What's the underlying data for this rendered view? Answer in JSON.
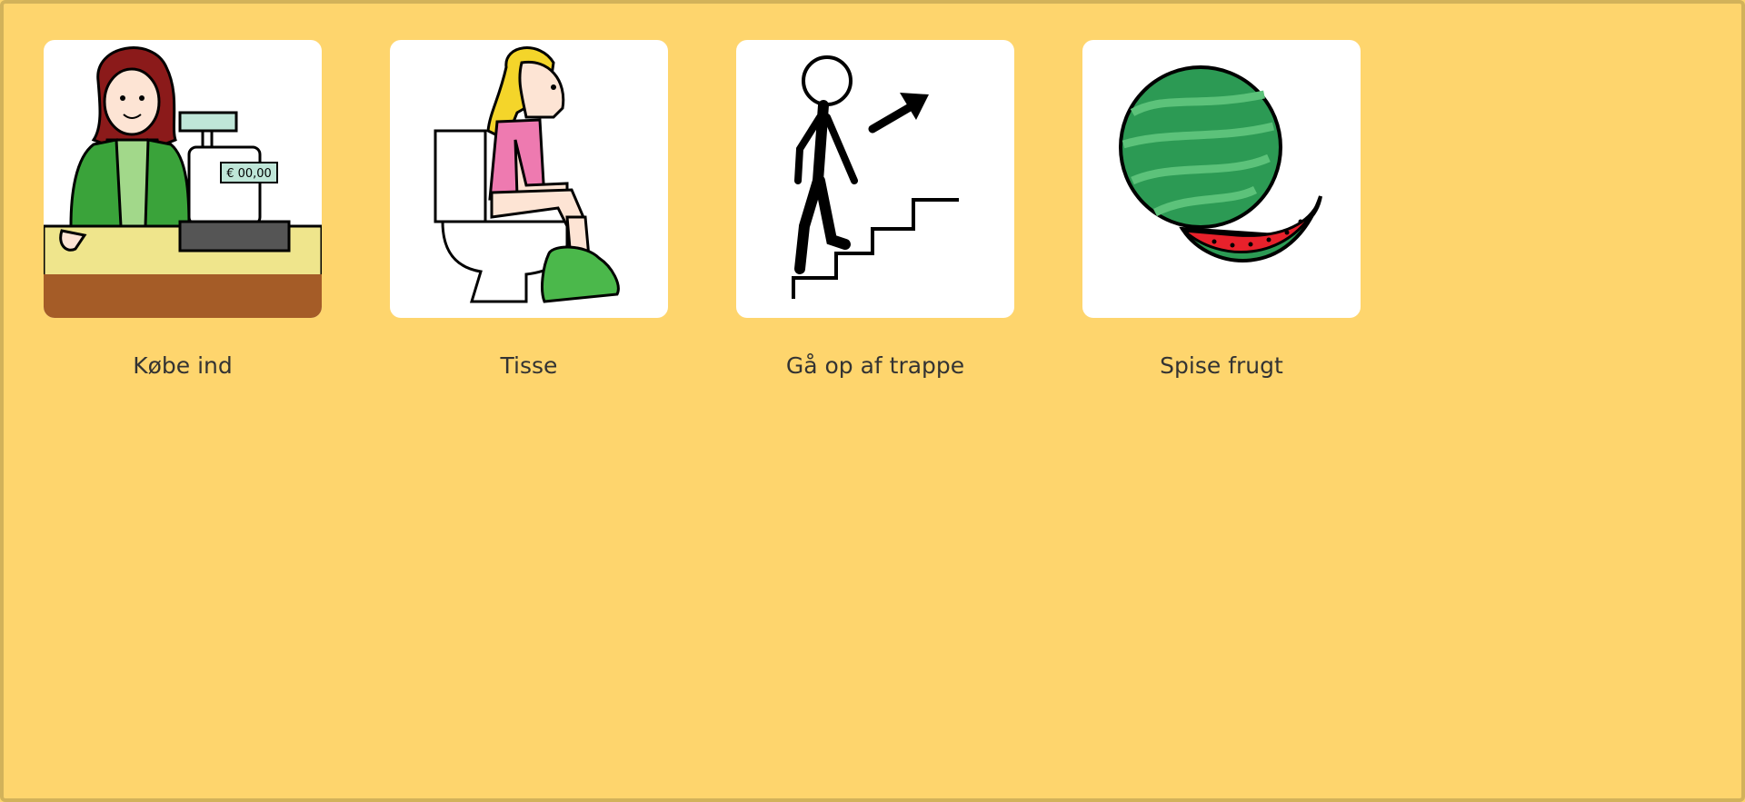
{
  "board": {
    "background": "#fed56d",
    "cards": [
      {
        "label": "Købe ind",
        "pictogram": "shopping-cashier-icon",
        "register_display": "€ 00,00"
      },
      {
        "label": "Tisse",
        "pictogram": "toilet-pee-icon"
      },
      {
        "label": "Gå op af trappe",
        "pictogram": "climb-stairs-icon"
      },
      {
        "label": "Spise frugt",
        "pictogram": "watermelon-icon"
      }
    ]
  }
}
